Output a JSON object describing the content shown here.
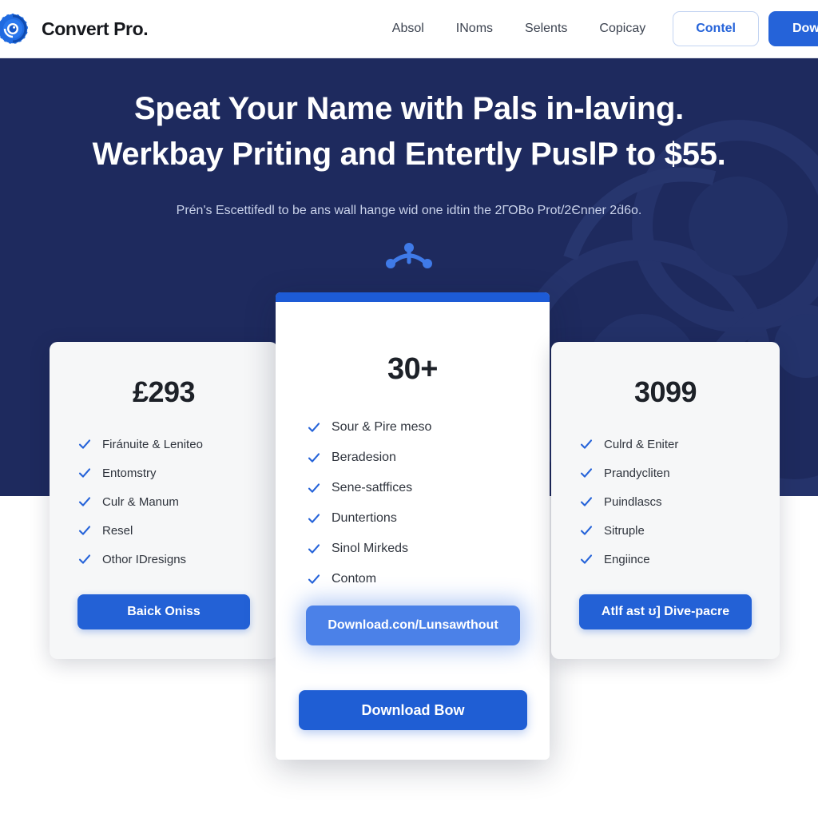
{
  "brand": {
    "logo_icon": "convert-swirl-logo-icon",
    "name": "Convert Pro."
  },
  "nav": {
    "links": [
      {
        "label": "Absol"
      },
      {
        "label": "INoms"
      },
      {
        "label": "Selents"
      },
      {
        "label": "Copicay"
      }
    ],
    "outline_button": "Contel",
    "primary_button": "Dowlo"
  },
  "hero": {
    "title_line1": "Speat Your Name with Pals in-laving.",
    "title_line2": "Werkbay Priting and Entertly PuslP to $55.",
    "subtitle": "Prén's Escettifedl to be ans wall hange wid one idtin the 2ГОBo Prot/2Єnner 2ḋ6o.",
    "node_icon": "share-node-icon",
    "background_color": "#1e2a5e",
    "decoration_icon": "faded-circle-watermark-icon"
  },
  "pricing": {
    "left_card": {
      "price": "£293",
      "features": [
        "Firánuite & Leniteo",
        "Entomstry",
        "Culr & Manum",
        "Resel",
        "Othor IDresigns"
      ],
      "button": "Baick Oniss"
    },
    "center_card": {
      "accent_color": "#1d5bd6",
      "price": "30+",
      "features": [
        "Sour & Pire meso",
        "Beradesion",
        "Sene-satffices",
        "Duntertions",
        "Sinol Mirkeds",
        "Contom"
      ],
      "glow_button": "Download.con/Lunsawthout",
      "solid_button": "Download Bow"
    },
    "right_card": {
      "price": "3099",
      "features": [
        "Culrd & Eniter",
        "Prandycliten",
        "Puindlascs",
        "Sitruple",
        "Engiince"
      ],
      "button": "Atlf ast ʊ] Dive-pacre"
    }
  },
  "colors": {
    "accent_blue": "#2563d9",
    "hero_navy": "#1e2a5e",
    "check_blue": "#2563d9"
  }
}
